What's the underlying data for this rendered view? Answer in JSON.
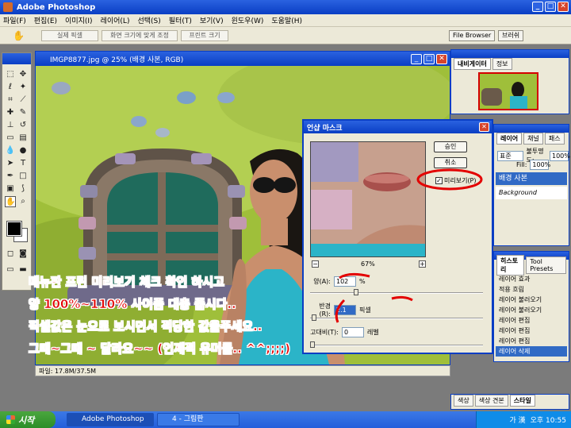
{
  "app": {
    "title": "Adobe Photoshop",
    "menu": [
      "파일(F)",
      "편집(E)",
      "이미지(I)",
      "레이어(L)",
      "선택(S)",
      "필터(T)",
      "보기(V)",
      "윈도우(W)",
      "도움말(H)"
    ]
  },
  "options_bar": {
    "buttons": [
      "실제 픽셀",
      "화면 크기에 맞게 조정",
      "프린트 크기"
    ],
    "palette_well": [
      "File Browser",
      "브러쉬"
    ]
  },
  "document": {
    "title": "IMGP8877.jpg @ 25% (배경 사본, RGB)",
    "status": "파일: 17.8M/37.5M"
  },
  "navigator": {
    "tabs": [
      "내비게이터",
      "정보"
    ]
  },
  "layers": {
    "tabs": [
      "레이어",
      "채널",
      "패스"
    ],
    "mode": "표준",
    "opacity_label": "불투명도:",
    "opacity": "100%",
    "fill_label": "Fill:",
    "fill": "100%",
    "items": [
      "배경 사본",
      "Background"
    ]
  },
  "history": {
    "tabs": [
      "히스토리",
      "Tool Presets"
    ],
    "items": [
      "레이어 효과",
      "적용 흐림",
      "레이어 불러오기",
      "레이어 불러오기",
      "레이어 편집",
      "레이어 편집",
      "레이어 편집",
      "레이어 삭제"
    ]
  },
  "bottom_tabs": [
    "색상",
    "색상 견본",
    "스타일"
  ],
  "dialog": {
    "title": "언샵 마스크",
    "ok": "승인",
    "cancel": "취소",
    "preview_label": "미리보기(P)",
    "zoom": "67%",
    "amount_label": "양(A):",
    "amount": "102",
    "amount_unit": "%",
    "radius_label": "반경(R):",
    "radius": "2.1",
    "radius_unit": "픽셀",
    "threshold_label": "고대비(T):",
    "threshold": "0",
    "threshold_unit": "레벨",
    "amount_level": 0.26,
    "radius_level": 0.01,
    "threshold_level": 0.0
  },
  "annotations": [
    "매뉴판 프린 미리보기 체크 확인 하시고",
    "양 100%~110% 사이즘 대충 줍시다..",
    "픽셀값은 눈으로 보시면서 적당한 값을주세요..",
    "그때~그때 ~ 달라요~~ (언제적 유머를.. ^^;;;;)"
  ],
  "taskbar": {
    "start": "시작",
    "items": [
      "Adobe Photoshop",
      "4 - 그림판"
    ],
    "ime": "가 漢",
    "clock": "오후 10:55"
  }
}
